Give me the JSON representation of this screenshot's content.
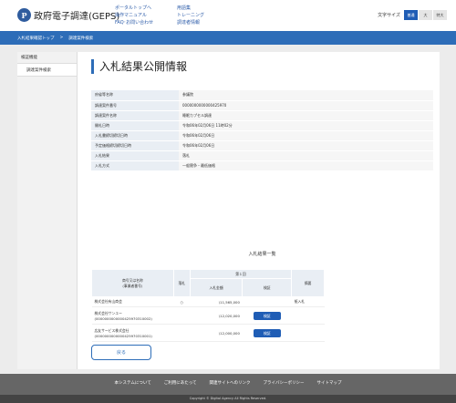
{
  "header": {
    "logo_mark": "P",
    "title": "政府電子調達(GEPS)",
    "links_col1": [
      "ポータルトップへ",
      "操作マニュアル",
      "FAQ･お問い合わせ"
    ],
    "links_col2": [
      "用語集",
      "トレーニング",
      "調達者情報"
    ],
    "font_size_label": "文字サイズ",
    "font_sizes": [
      "普通",
      "大",
      "特大"
    ]
  },
  "breadcrumb": [
    "入札結果確認トップ",
    "調達案件検索"
  ],
  "sidebar": {
    "heading": "検証機能",
    "items": [
      "調達案件検索"
    ]
  },
  "page_title": "入札結果公開情報",
  "info": [
    {
      "label": "府省等名称",
      "value": "参議院"
    },
    {
      "label": "調達案件番号",
      "value": "0000000000000425970"
    },
    {
      "label": "調達案件名称",
      "value": "睡眠カプセル調達"
    },
    {
      "label": "開札日時",
      "value": "令和06年02月06日 11時02分"
    },
    {
      "label": "入札書締切締切日時",
      "value": "令和06年02月06日"
    },
    {
      "label": "予定価格締切締切日時",
      "value": "令和06年02月06日"
    },
    {
      "label": "入札結果",
      "value": "落札"
    },
    {
      "label": "入札方式",
      "value": "一般競争・最低価格"
    }
  ],
  "results": {
    "section_title": "入札結果一覧",
    "headers": {
      "company": "商号又は名称\n(事業者番号)",
      "awarded": "落札",
      "round": "第１回",
      "amount": "入札金額",
      "verify": "検証",
      "remarks": "摘要"
    },
    "rows": [
      {
        "company": "株式会社有山商会",
        "company_id": "",
        "awarded": "○",
        "amount": "\\11,565,000",
        "has_verify": false,
        "remarks": "紙入札"
      },
      {
        "company": "株式会社サンユー",
        "company_id": "(0000000000000425970310002)",
        "awarded": "",
        "amount": "\\12,020,000",
        "has_verify": true,
        "remarks": ""
      },
      {
        "company": "広友サービス株式会社",
        "company_id": "(0000000000000425970310001)",
        "awarded": "",
        "amount": "\\12,000,000",
        "has_verify": true,
        "remarks": ""
      }
    ],
    "verify_label": "検証"
  },
  "back_label": "戻る",
  "footer": {
    "links": [
      "本システムについて",
      "ご利用にあたって",
      "関連サイトへのリンク",
      "プライバシーポリシー",
      "サイトマップ"
    ],
    "copyright": "Copyright © Digital Agency All Rights Reserved."
  },
  "colors": {
    "accent": "#2d6db8",
    "button": "#1f5db5",
    "footer": "#666666"
  }
}
